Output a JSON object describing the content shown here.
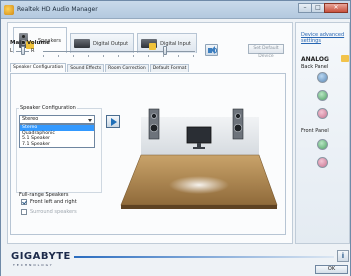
{
  "window": {
    "title": "Realtek HD Audio Manager",
    "controls": {
      "minimize": "–",
      "maximize": "□",
      "close": "✕"
    }
  },
  "device_tabs": [
    {
      "label": "Speakers",
      "active": true,
      "icon": "speaker-icon"
    },
    {
      "label": "Digital Output",
      "active": false,
      "icon": "digital-output-icon"
    },
    {
      "label": "Digital Input",
      "active": false,
      "icon": "digital-input-icon"
    }
  ],
  "volume": {
    "label": "Main Volume",
    "left_label": "L",
    "right_label": "R",
    "balance": 0.5,
    "level": 0.8,
    "set_default_label": "Set Default Device"
  },
  "sub_tabs": [
    {
      "label": "Speaker Configuration",
      "active": true
    },
    {
      "label": "Sound Effects",
      "active": false
    },
    {
      "label": "Room Correction",
      "active": false
    },
    {
      "label": "Default Format",
      "active": false
    }
  ],
  "speaker_config": {
    "group_label": "Speaker Configuration",
    "selected": "Stereo",
    "options": [
      "Stereo",
      "Quadraphonic",
      "5.1 Speaker",
      "7.1 Speaker"
    ],
    "highlighted": "Stereo"
  },
  "full_range": {
    "label": "Full-range Speakers",
    "front": {
      "label": "Front left and right",
      "checked": true
    },
    "surround": {
      "label": "Surround speakers",
      "checked": false,
      "disabled": true
    }
  },
  "right_panel": {
    "advanced_link_line1": "Device advanced",
    "advanced_link_line2": "settings",
    "analog_label": "ANALOG",
    "back_panel_label": "Back Panel",
    "front_panel_label": "Front Panel",
    "back_jacks": [
      "blue",
      "green",
      "pink"
    ],
    "front_jacks": [
      "green",
      "pink"
    ]
  },
  "footer": {
    "brand": "GIGABYTE",
    "brand_sub": "TECHNOLOGY",
    "info_label": "i",
    "ok_label": "OK"
  }
}
